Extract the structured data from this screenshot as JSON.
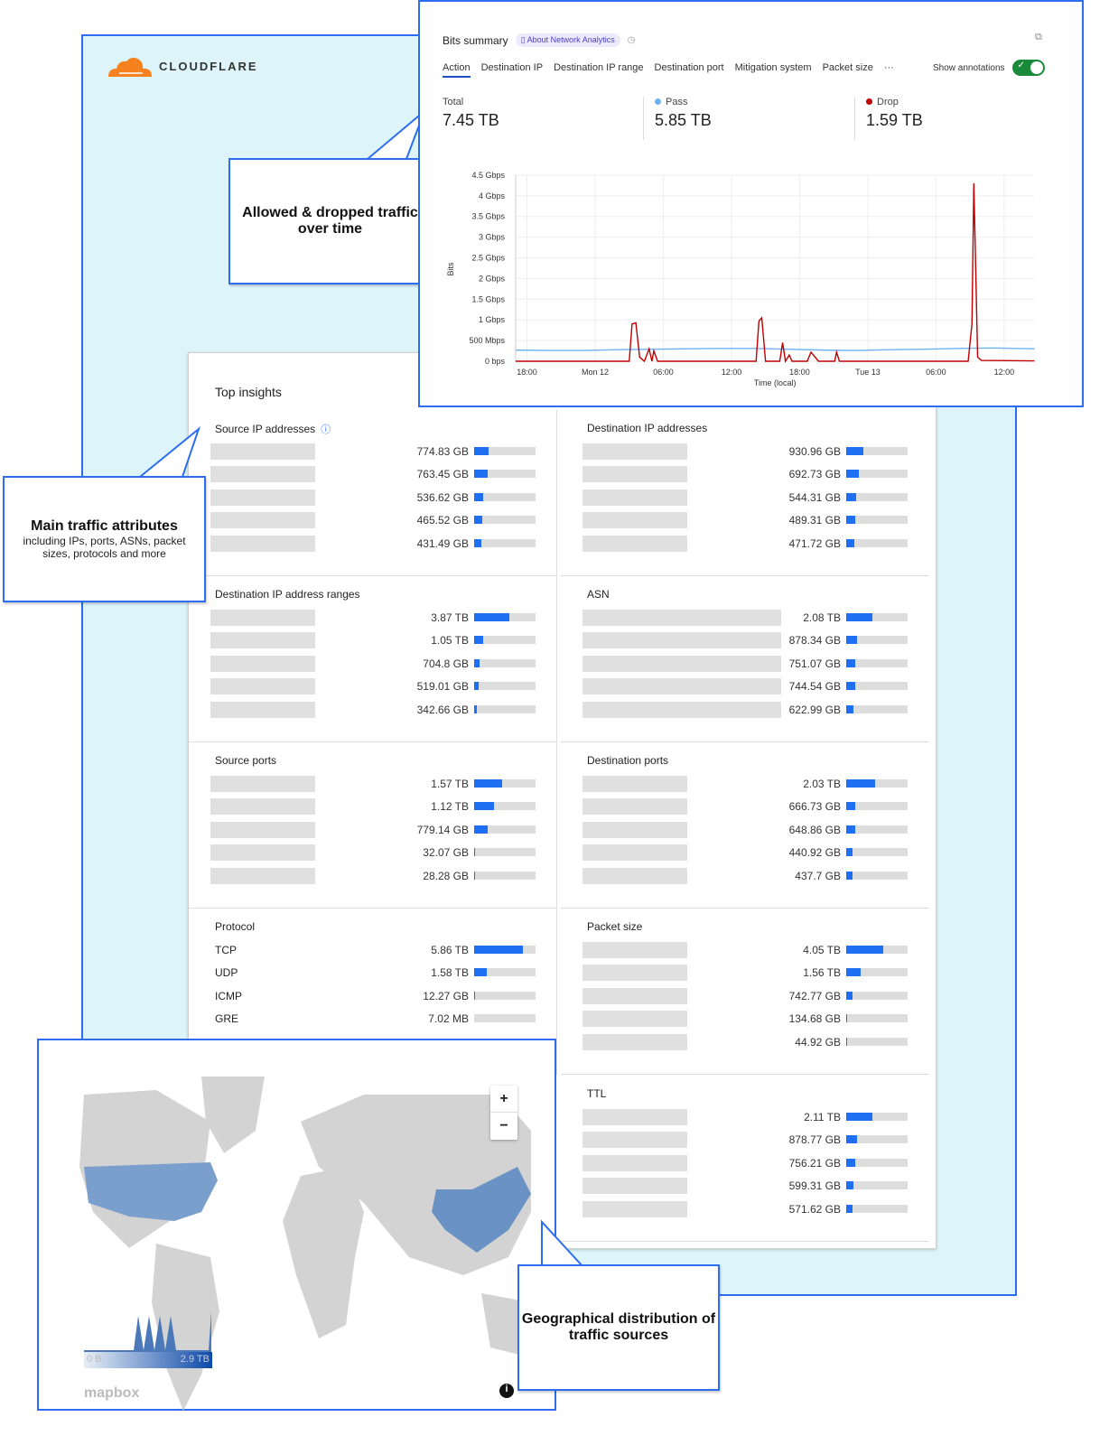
{
  "brand": {
    "name": "CLOUDFLARE",
    "color": "#f6821f"
  },
  "callouts": {
    "chart": "Allowed & dropped traffic over time",
    "attributes_title": "Main traffic attributes",
    "attributes_sub": "including IPs, ports, ASNs, packet sizes, protocols and more",
    "geo": "Geographical distribution of traffic sources"
  },
  "summary": {
    "title": "Bits summary",
    "about_label": "About Network Analytics",
    "tabs": [
      "Action",
      "Destination IP",
      "Destination IP range",
      "Destination port",
      "Mitigation system",
      "Packet size",
      "···"
    ],
    "active_tab": "Action",
    "show_annotations": "Show annotations",
    "annotations_on": true,
    "stats": [
      {
        "label": "Total",
        "value": "7.45 TB"
      },
      {
        "label": "Pass",
        "value": "5.85 TB",
        "color": "#6cb2f5"
      },
      {
        "label": "Drop",
        "value": "1.59 TB",
        "color": "#c00000"
      }
    ]
  },
  "chart_data": {
    "type": "line",
    "ylabel": "Bits",
    "xlabel": "Time (local)",
    "yticks": [
      "0 bps",
      "500 Mbps",
      "1 Gbps",
      "1.5 Gbps",
      "2 Gbps",
      "2.5 Gbps",
      "3 Gbps",
      "3.5 Gbps",
      "4 Gbps",
      "4.5 Gbps"
    ],
    "ylim_gbps": [
      0,
      4.5
    ],
    "xticks": [
      "18:00",
      "Mon 12",
      "06:00",
      "12:00",
      "18:00",
      "Tue 13",
      "06:00",
      "12:00"
    ],
    "xlim": [
      "Sun 17:00",
      "Tue 14:40"
    ],
    "grid": true,
    "series": [
      {
        "name": "Pass",
        "color": "#6cb2f5",
        "points": [
          [
            "Sun 17:00",
            0.27
          ],
          [
            "Sun 20:00",
            0.26
          ],
          [
            "Sun 23:00",
            0.26
          ],
          [
            "Mon 02:00",
            0.28
          ],
          [
            "Mon 05:00",
            0.29
          ],
          [
            "Mon 08:00",
            0.3
          ],
          [
            "Mon 11:00",
            0.31
          ],
          [
            "Mon 14:00",
            0.31
          ],
          [
            "Mon 17:00",
            0.29
          ],
          [
            "Mon 20:00",
            0.27
          ],
          [
            "Mon 23:00",
            0.26
          ],
          [
            "Tue 02:00",
            0.28
          ],
          [
            "Tue 05:00",
            0.29
          ],
          [
            "Tue 08:00",
            0.31
          ],
          [
            "Tue 11:00",
            0.32
          ],
          [
            "Tue 14:40",
            0.3
          ]
        ]
      },
      {
        "name": "Drop",
        "color": "#c00000",
        "points": [
          [
            "Sun 17:00",
            0
          ],
          [
            "Mon 03:00",
            0
          ],
          [
            "Mon 03:15",
            0.9
          ],
          [
            "Mon 03:35",
            0.93
          ],
          [
            "Mon 03:55",
            0.1
          ],
          [
            "Mon 04:20",
            0
          ],
          [
            "Mon 04:45",
            0.3
          ],
          [
            "Mon 05:00",
            0
          ],
          [
            "Mon 05:10",
            0.25
          ],
          [
            "Mon 05:30",
            0
          ],
          [
            "Mon 14:10",
            0
          ],
          [
            "Mon 14:25",
            0.97
          ],
          [
            "Mon 14:40",
            1.05
          ],
          [
            "Mon 15:00",
            0
          ],
          [
            "Mon 16:15",
            0
          ],
          [
            "Mon 16:30",
            0.45
          ],
          [
            "Mon 16:45",
            0
          ],
          [
            "Mon 17:05",
            0.15
          ],
          [
            "Mon 17:20",
            0
          ],
          [
            "Mon 18:40",
            0
          ],
          [
            "Mon 19:00",
            0.22
          ],
          [
            "Mon 19:40",
            0
          ],
          [
            "Mon 21:05",
            0
          ],
          [
            "Mon 21:15",
            0.22
          ],
          [
            "Mon 21:30",
            0
          ],
          [
            "Tue 08:50",
            0
          ],
          [
            "Tue 09:10",
            0.9
          ],
          [
            "Tue 09:20",
            4.3
          ],
          [
            "Tue 09:40",
            0.1
          ],
          [
            "Tue 10:00",
            0.02
          ],
          [
            "Tue 14:40",
            0.01
          ]
        ]
      }
    ]
  },
  "insights": {
    "title": "Top insights",
    "sections": [
      {
        "title": "Source IP addresses",
        "info": true,
        "rows": [
          {
            "value": "774.83 GB",
            "fraction": 0.23
          },
          {
            "value": "763.45 GB",
            "fraction": 0.22
          },
          {
            "value": "536.62 GB",
            "fraction": 0.15
          },
          {
            "value": "465.52 GB",
            "fraction": 0.13
          },
          {
            "value": "431.49 GB",
            "fraction": 0.12
          }
        ]
      },
      {
        "title": "Destination IP addresses",
        "rows": [
          {
            "value": "930.96 GB",
            "fraction": 0.28
          },
          {
            "value": "692.73 GB",
            "fraction": 0.2
          },
          {
            "value": "544.31 GB",
            "fraction": 0.16
          },
          {
            "value": "489.31 GB",
            "fraction": 0.14
          },
          {
            "value": "471.72 GB",
            "fraction": 0.13
          }
        ]
      },
      {
        "title": "Destination IP address ranges",
        "rows": [
          {
            "value": "3.87 TB",
            "fraction": 0.58
          },
          {
            "value": "1.05 TB",
            "fraction": 0.15
          },
          {
            "value": "704.8 GB",
            "fraction": 0.09
          },
          {
            "value": "519.01 GB",
            "fraction": 0.07
          },
          {
            "value": "342.66 GB",
            "fraction": 0.05
          }
        ]
      },
      {
        "title": "ASN",
        "wide": true,
        "rows": [
          {
            "value": "2.08 TB",
            "fraction": 0.42
          },
          {
            "value": "878.34 GB",
            "fraction": 0.17
          },
          {
            "value": "751.07 GB",
            "fraction": 0.15
          },
          {
            "value": "744.54 GB",
            "fraction": 0.15
          },
          {
            "value": "622.99 GB",
            "fraction": 0.12
          }
        ]
      },
      {
        "title": "Source ports",
        "rows": [
          {
            "value": "1.57 TB",
            "fraction": 0.45
          },
          {
            "value": "1.12 TB",
            "fraction": 0.32
          },
          {
            "value": "779.14 GB",
            "fraction": 0.22
          },
          {
            "value": "32.07 GB",
            "fraction": 0.01
          },
          {
            "value": "28.28 GB",
            "fraction": 0.01
          }
        ]
      },
      {
        "title": "Destination ports",
        "rows": [
          {
            "value": "2.03 TB",
            "fraction": 0.47
          },
          {
            "value": "666.73 GB",
            "fraction": 0.15
          },
          {
            "value": "648.86 GB",
            "fraction": 0.15
          },
          {
            "value": "440.92 GB",
            "fraction": 0.1
          },
          {
            "value": "437.7 GB",
            "fraction": 0.1
          }
        ]
      },
      {
        "title": "Protocol",
        "rows": [
          {
            "label": "TCP",
            "value": "5.86 TB",
            "fraction": 0.79
          },
          {
            "label": "UDP",
            "value": "1.58 TB",
            "fraction": 0.21
          },
          {
            "label": "ICMP",
            "value": "12.27 GB",
            "fraction": 0.01
          },
          {
            "label": "GRE",
            "value": "7.02 MB",
            "fraction": 0
          }
        ]
      },
      {
        "title": "Packet size",
        "rows": [
          {
            "value": "4.05 TB",
            "fraction": 0.61
          },
          {
            "value": "1.56 TB",
            "fraction": 0.24
          },
          {
            "value": "742.77 GB",
            "fraction": 0.11
          },
          {
            "value": "134.68 GB",
            "fraction": 0.02
          },
          {
            "value": "44.92 GB",
            "fraction": 0.01
          }
        ]
      },
      {
        "title": "TTL",
        "rows": [
          {
            "value": "2.11 TB",
            "fraction": 0.42
          },
          {
            "value": "878.77 GB",
            "fraction": 0.17
          },
          {
            "value": "756.21 GB",
            "fraction": 0.15
          },
          {
            "value": "599.31 GB",
            "fraction": 0.12
          },
          {
            "value": "571.62 GB",
            "fraction": 0.11
          }
        ]
      }
    ]
  },
  "map": {
    "zoom_in": "+",
    "zoom_out": "−",
    "legend_min": "0 B",
    "legend_max": "2.9 TB",
    "attribution": "mapbox",
    "highlight_color": "#6b92c4",
    "land_color": "#d3d3d3"
  }
}
